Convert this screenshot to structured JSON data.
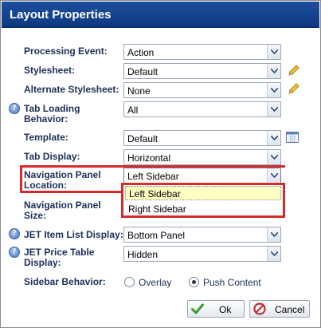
{
  "dialog": {
    "title": "Layout Properties"
  },
  "fields": {
    "processing_event": {
      "label": "Processing Event:",
      "value": "Action"
    },
    "stylesheet": {
      "label": "Stylesheet:",
      "value": "Default"
    },
    "alternate_stylesheet": {
      "label": "Alternate Stylesheet:",
      "value": "None"
    },
    "tab_loading_behavior": {
      "label_line1": "Tab Loading",
      "label_line2": "Behavior:",
      "value": "All"
    },
    "template": {
      "label": "Template:",
      "value": "Default"
    },
    "tab_display": {
      "label": "Tab Display:",
      "value": "Horizontal"
    },
    "navigation_panel_location": {
      "label_line1": "Navigation Panel",
      "label_line2": "Location:",
      "value": "Left Sidebar",
      "options": [
        "Left Sidebar",
        "Right Sidebar"
      ]
    },
    "navigation_panel_size": {
      "label_line1": "Navigation Panel",
      "label_line2": "Size:"
    },
    "jet_item_list_display": {
      "label": "JET Item List Display:",
      "value": "Bottom Panel"
    },
    "jet_price_table_display": {
      "label_line1": "JET Price Table",
      "label_line2": "Display:",
      "value": "Hidden"
    },
    "sidebar_behavior": {
      "label": "Sidebar Behavior:",
      "options": [
        {
          "label": "Overlay",
          "selected": false
        },
        {
          "label": "Push Content",
          "selected": true
        }
      ]
    }
  },
  "buttons": {
    "ok": "Ok",
    "cancel": "Cancel"
  },
  "colors": {
    "title_bar": "#0f3a82",
    "label_text": "#1b2f5a",
    "highlight_border": "#d72b2b",
    "dropdown_hover": "#ffffc4"
  },
  "icons": [
    "help-icon",
    "pencil-icon",
    "calendar-icon",
    "chevron-down-icon",
    "checkmark-icon",
    "no-entry-icon"
  ]
}
